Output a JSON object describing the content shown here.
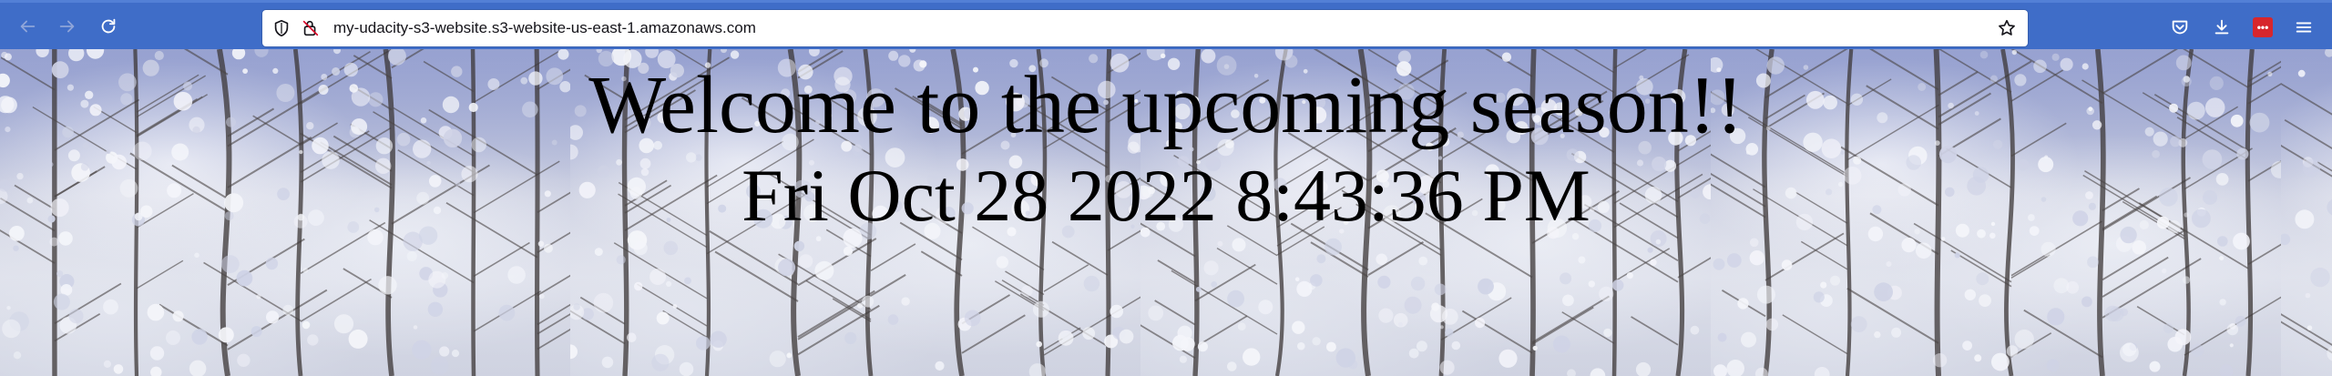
{
  "browser": {
    "url": "my-udacity-s3-website.s3-website-us-east-1.amazonaws.com",
    "extension_badge": "•••",
    "icons": {
      "back": "arrow-left-icon",
      "forward": "arrow-right-icon",
      "reload": "reload-icon",
      "security": "shield-icon",
      "insecure": "insecure-lock-icon",
      "bookmark": "star-icon",
      "pocket": "pocket-icon",
      "downloads": "download-icon",
      "menu": "hamburger-menu-icon"
    },
    "colors": {
      "toolbar": "#3f6dc8",
      "extension": "#d7262c"
    }
  },
  "page": {
    "heading": "Welcome to the upcoming season!!",
    "datetime": "Fri Oct 28 2022 8:43:36 PM",
    "background": "snowy-trees-image"
  }
}
